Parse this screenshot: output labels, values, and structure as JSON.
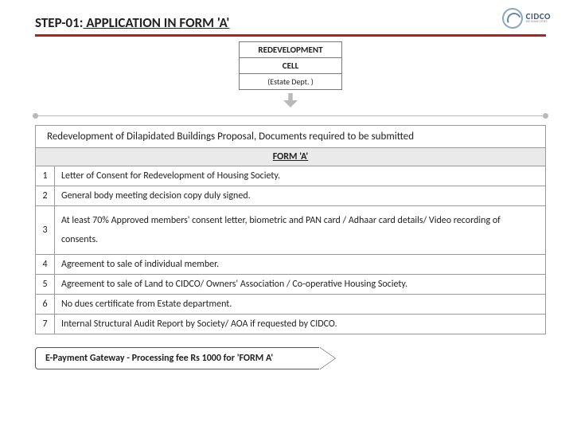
{
  "header": {
    "step": "STEP-01:",
    "title_rest": " APPLICATION IN ",
    "form": "FORM 'A'",
    "brand": "CIDCO",
    "tagline": "WE MAKE CITIES"
  },
  "cell": {
    "line1": "REDEVELOPMENT",
    "line2": "CELL",
    "line3": "(Estate Dept. )"
  },
  "table": {
    "proposal": "Redevelopment of Dilapidated Buildings Proposal, Documents required to be submitted",
    "form_header": " FORM  'A'",
    "rows": [
      {
        "n": "1",
        "text": "Letter of Consent for Redevelopment of Housing Society."
      },
      {
        "n": "2",
        "text": "General body meeting decision copy duly signed."
      },
      {
        "n": "3",
        "text": "At least 70% Approved members' consent letter, biometric and PAN card / Adhaar card details/ Video recording of consents."
      },
      {
        "n": "4",
        "text": "Agreement to sale of individual member."
      },
      {
        "n": "5",
        "text": "Agreement to sale of Land to CIDCO/ Owners' Association / Co-operative Housing Society."
      },
      {
        "n": "6",
        "text": "No dues certificate from Estate department."
      },
      {
        "n": "7",
        "text": "Internal Structural Audit Report  by Society/ AOA if requested by CIDCO."
      }
    ]
  },
  "callout": "E-Payment Gateway - Processing fee Rs 1000 for  'FORM A'"
}
